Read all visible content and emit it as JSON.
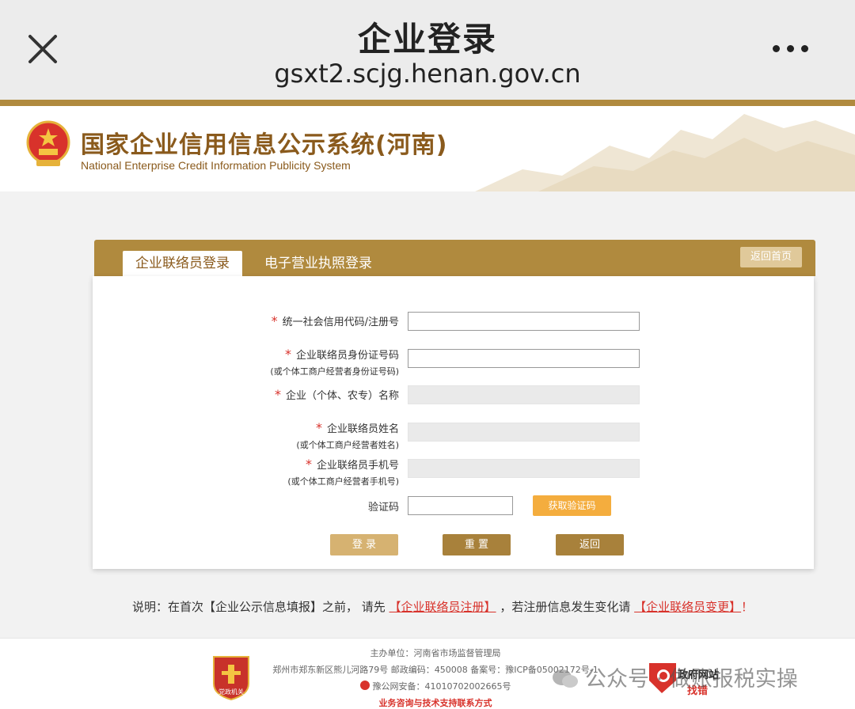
{
  "browser": {
    "title": "企业登录",
    "url": "gsxt2.scjg.henan.gov.cn"
  },
  "header": {
    "title": "国家企业信用信息公示系统(河南)",
    "subtitle": "National Enterprise Credit Information Publicity System"
  },
  "panel": {
    "tab_active": "企业联络员登录",
    "tab_other": "电子营业执照登录",
    "home_button": "返回首页"
  },
  "form": {
    "required_mark": "*",
    "fields": [
      {
        "label": "统一社会信用代码/注册号",
        "sub": "",
        "value": ""
      },
      {
        "label": "企业联络员身份证号码",
        "sub": "(或个体工商户经营者身份证号码)",
        "value": ""
      },
      {
        "label": "企业（个体、农专）名称",
        "sub": "",
        "value": ""
      },
      {
        "label": "企业联络员姓名",
        "sub": "(或个体工商户经营者姓名)",
        "value": ""
      },
      {
        "label": "企业联络员手机号",
        "sub": "(或个体工商户经营者手机号)",
        "value": ""
      }
    ],
    "captcha_label": "验证码",
    "captcha_value": "",
    "get_code_button": "获取验证码",
    "login_button": "登 录",
    "reset_button": "重 置",
    "back_button": "返回"
  },
  "note": {
    "prefix": "说明：在首次【企业公示信息填报】之前， 请先 ",
    "link1": "【企业联络员注册】",
    "middle": " ，若注册信息发生变化请 ",
    "link2": "【企业联络员变更】",
    "suffix": "！"
  },
  "footer": {
    "line1": "主办单位：河南省市场监督管理局",
    "line2": "郑州市郑东新区熊儿河路79号 邮政编码：450008 备案号：豫ICP备05002172号-1",
    "line3": "豫公网安备：41010702002665号",
    "line4": "业务咨询与技术支持联系方式",
    "badge_text": "党政机关",
    "gov_line1": "政府网站",
    "gov_line2": "找错"
  },
  "watermark": "公众号 · 做账报税实操",
  "colors": {
    "gold": "#b08a3e",
    "light_gold": "#d6b271",
    "orange": "#f4ad3e",
    "red": "#d8322b"
  }
}
